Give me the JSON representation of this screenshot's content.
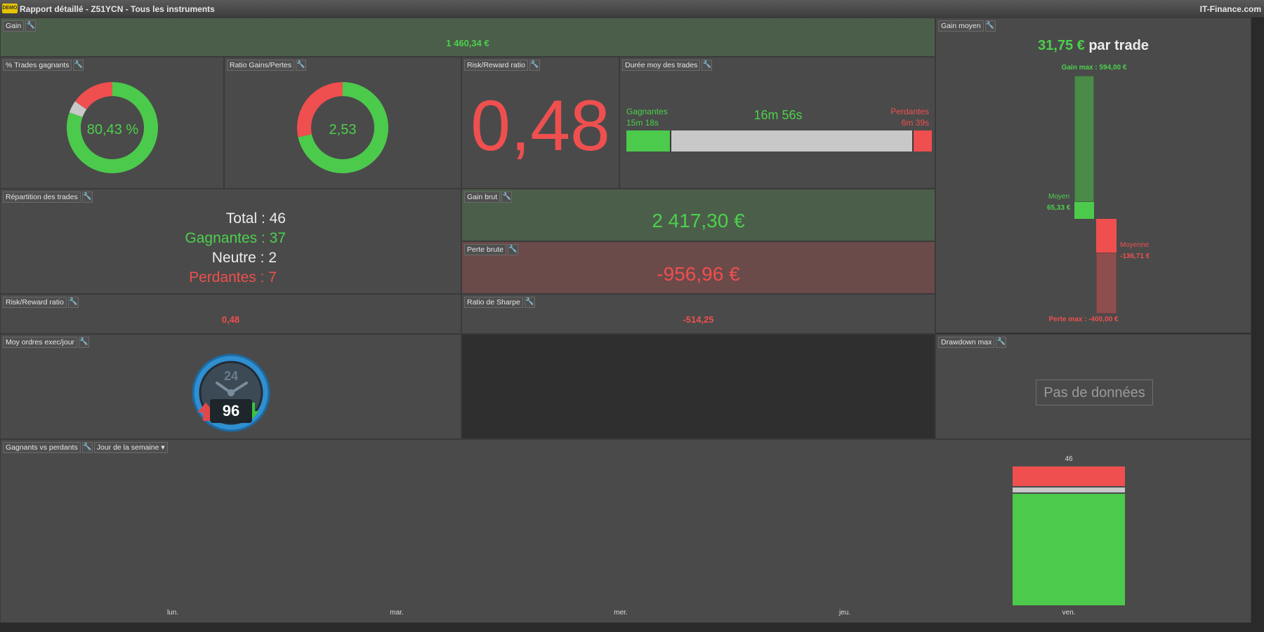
{
  "window": {
    "badge": "DEMO",
    "title": "Rapport détaillé - Z51YCN - Tous les instruments",
    "brand": "IT-Finance.com"
  },
  "panels": {
    "gain": {
      "title": "Gain",
      "value": "1 460,34 €"
    },
    "pct_trades": {
      "title": "% Trades gagnants",
      "value": "80,43 %"
    },
    "ratio_gp": {
      "title": "Ratio Gains/Pertes",
      "value": "2,53"
    },
    "rr_big": {
      "title": "Risk/Reward ratio",
      "value": "0,48"
    },
    "duree": {
      "title": "Durée moy des trades",
      "win_label": "Gagnantes",
      "win_value": "15m 18s",
      "avg_value": "16m 56s",
      "loss_label": "Perdantes",
      "loss_value": "6m 39s"
    },
    "repartition": {
      "title": "Répartition des trades",
      "total": "Total : 46",
      "gagnantes": "Gagnantes : 37",
      "neutre": "Neutre : 2",
      "perdantes": "Perdantes : 7"
    },
    "gain_brut": {
      "title": "Gain brut",
      "value": "2 417,30 €"
    },
    "perte_brute": {
      "title": "Perte brute",
      "value": "-956,96 €"
    },
    "rr_small": {
      "title": "Risk/Reward ratio",
      "value": "0,48"
    },
    "sharpe": {
      "title": "Ratio de Sharpe",
      "value": "-514,25"
    },
    "ordres": {
      "title": "Moy ordres exec/jour",
      "clock_number": "24",
      "value": "96"
    },
    "gain_moyen": {
      "title": "Gain moyen",
      "value": "31,75 €",
      "suffix": " par trade",
      "gain_max": "Gain max : 594,00 €",
      "moyen_label": "Moyen",
      "moyen_value": "65,33 €",
      "moyenne_label": "Moyenne",
      "moyenne_value": "-136,71 €",
      "perte_max": "Perte max : -400,00 €"
    },
    "drawdown": {
      "title": "Drawdown max",
      "nodata": "Pas de données"
    },
    "gvp": {
      "title": "Gagnants vs perdants",
      "dropdown": "Jour de la semaine"
    }
  },
  "colors": {
    "green": "#4cca4c",
    "red": "#ef4f4f",
    "neutral": "#c8c8c8"
  },
  "icons": {
    "wrench": "wrench-icon",
    "dropdown": "caret-down-icon"
  },
  "chart_data": [
    {
      "type": "pie",
      "title": "% Trades gagnants",
      "series": [
        {
          "name": "Gagnantes",
          "value": 37
        },
        {
          "name": "Neutre",
          "value": 2
        },
        {
          "name": "Perdantes",
          "value": 7
        }
      ]
    },
    {
      "type": "pie",
      "title": "Ratio Gains/Pertes",
      "series": [
        {
          "name": "Gain brut",
          "value": 2417.3
        },
        {
          "name": "Perte brute",
          "value": 956.96
        }
      ]
    },
    {
      "type": "bar",
      "title": "Gagnants vs perdants",
      "categories": [
        "lun.",
        "mar.",
        "mer.",
        "jeu.",
        "ven."
      ],
      "series": [
        {
          "values": [
            0,
            0,
            0,
            0,
            37
          ]
        },
        {
          "values": [
            0,
            0,
            0,
            0,
            2
          ]
        },
        {
          "values": [
            0,
            0,
            0,
            0,
            7
          ]
        }
      ],
      "totals_labels": [
        "",
        "",
        "",
        "",
        "46"
      ],
      "stacked": true
    }
  ]
}
